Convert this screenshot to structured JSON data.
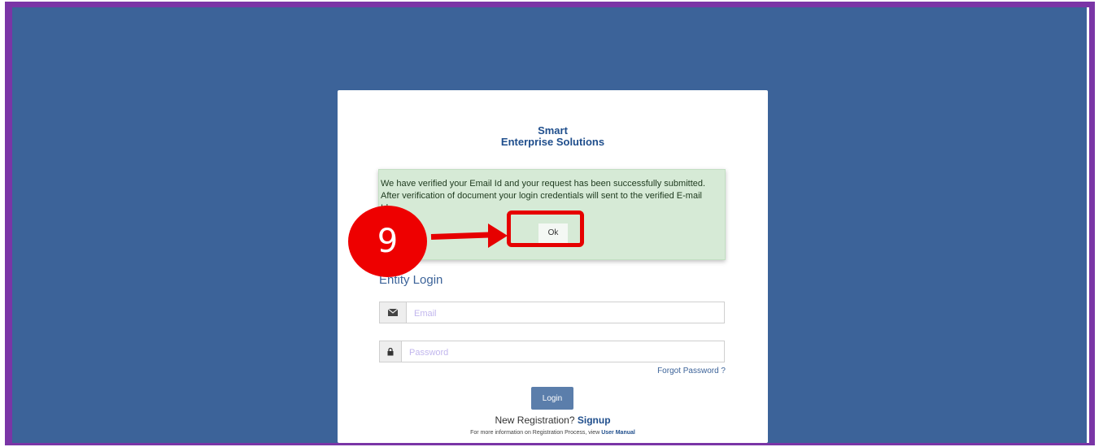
{
  "brand": {
    "line1": "Smart",
    "line2": "Enterprise Solutions"
  },
  "alert": {
    "message": "We have verified your Email Id and your request has been successfully submitted. After verification of document your login credentials will sent to the verified E-mail Id.",
    "ok_label": "Ok"
  },
  "annotation": {
    "step_number": "9"
  },
  "login": {
    "title": "Entity Login",
    "email_placeholder": "Email",
    "password_placeholder": "Password",
    "forgot_password": "Forgot Password ?",
    "login_button": "Login",
    "new_registration_text": "New Registration?",
    "signup_link": "Signup",
    "info_text": "For more information on Registration Process, view",
    "manual_link": "User Manual"
  },
  "colors": {
    "background": "#3c6399",
    "frame": "#7a35a6",
    "alert_bg": "#d6ead6",
    "annotation_red": "#e60000"
  }
}
